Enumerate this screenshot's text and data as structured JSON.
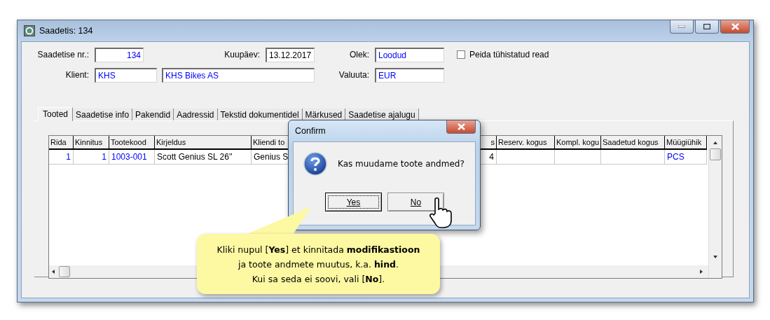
{
  "window": {
    "title": "Saadetis: 134"
  },
  "form": {
    "number": {
      "label": "Saadetise nr.:",
      "value": "134"
    },
    "date": {
      "label": "Kuupäev:",
      "value": "13.12.2017"
    },
    "status": {
      "label": "Olek:",
      "value": "Loodud"
    },
    "hide_cancelled": {
      "label": "Peida tühistatud read",
      "checked": false
    },
    "client": {
      "label": "Klient:",
      "code": "KHS",
      "name": "KHS Bikes AS"
    },
    "currency": {
      "label": "Valuuta:",
      "value": "EUR"
    }
  },
  "tabs": [
    {
      "label": "Tooted",
      "selected": true
    },
    {
      "label": "Saadetise info",
      "selected": false
    },
    {
      "label": "Pakendid",
      "selected": false
    },
    {
      "label": "Aadressid",
      "selected": false
    },
    {
      "label": "Tekstid dokumentidel",
      "selected": false
    },
    {
      "label": "Märkused",
      "selected": false
    },
    {
      "label": "Saadetise ajalugu",
      "selected": false
    }
  ],
  "table": {
    "columns": [
      {
        "label": "Rida",
        "kind": "id"
      },
      {
        "label": "Kinnitus",
        "kind": "id"
      },
      {
        "label": "Tootekood",
        "kind": "code"
      },
      {
        "label": "Kirjeldus",
        "kind": "text"
      },
      {
        "label": "Kliendi to",
        "kind": "text"
      },
      {
        "label": "s",
        "kind": "qty"
      },
      {
        "label": "Reserv. kogus",
        "kind": "qty"
      },
      {
        "label": "Kompl. kogu",
        "kind": "qty"
      },
      {
        "label": "Saadetud kogus",
        "kind": "qty"
      },
      {
        "label": "Müügiühik",
        "kind": "code"
      }
    ],
    "rows": [
      [
        "1",
        "1",
        "1003-001",
        "Scott Genius SL 26''",
        "Genius S",
        "4",
        "",
        "",
        "",
        "PCS"
      ]
    ]
  },
  "dialog": {
    "title": "Confirm",
    "message": "Kas muudame toote andmed?",
    "buttons": [
      {
        "label": "Yes",
        "focused": true
      },
      {
        "label": "No",
        "focused": false
      }
    ]
  },
  "callout": {
    "lines": [
      "Kliki nupul [**Yes**] et kinnitada **modifikastioon**",
      "ja toote andmete muutus, k.a. **hind**.",
      "Kui sa seda ei soovi, vali [**No**]."
    ]
  }
}
